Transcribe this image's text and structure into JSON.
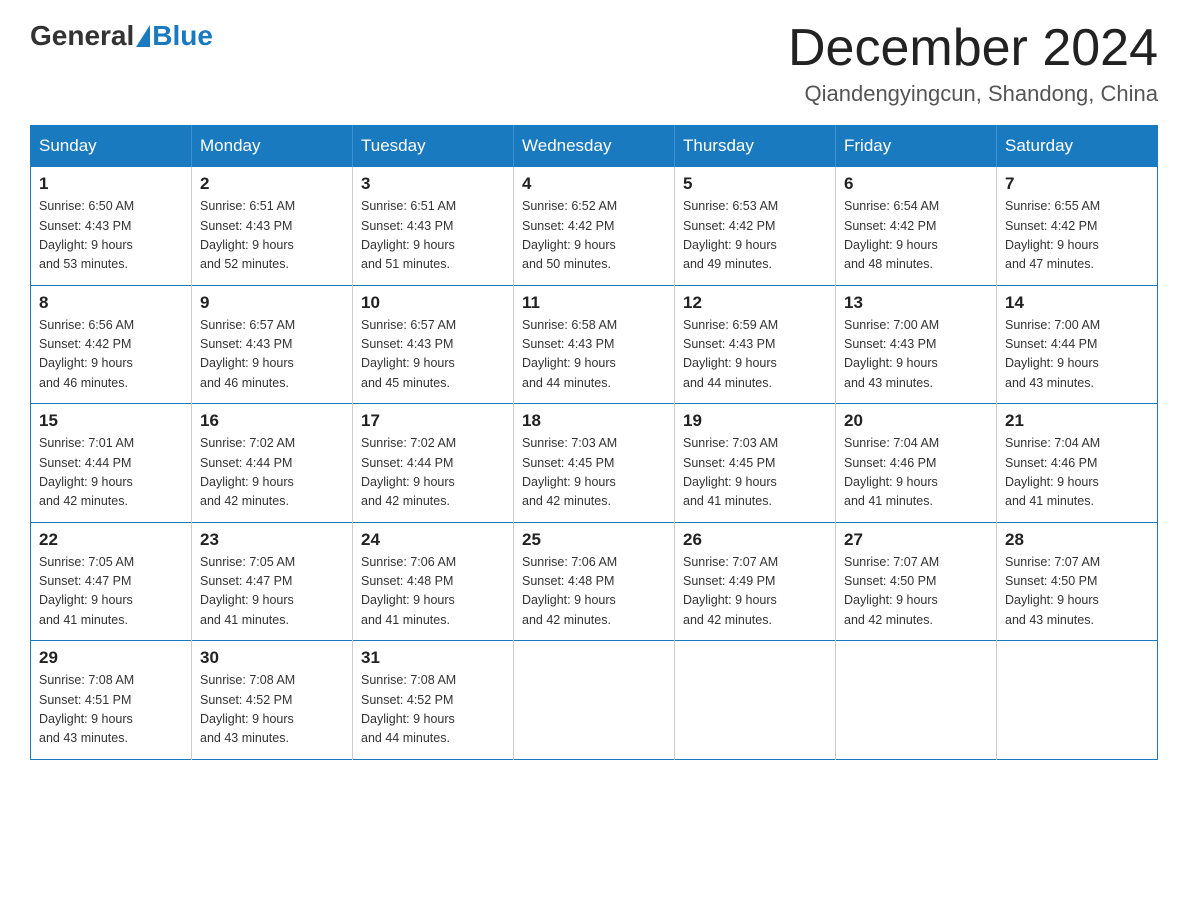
{
  "header": {
    "logo_general": "General",
    "logo_blue": "Blue",
    "month_title": "December 2024",
    "location": "Qiandengyingcun, Shandong, China"
  },
  "days_of_week": [
    "Sunday",
    "Monday",
    "Tuesday",
    "Wednesday",
    "Thursday",
    "Friday",
    "Saturday"
  ],
  "weeks": [
    [
      {
        "day": "1",
        "sunrise": "6:50 AM",
        "sunset": "4:43 PM",
        "daylight": "9 hours and 53 minutes."
      },
      {
        "day": "2",
        "sunrise": "6:51 AM",
        "sunset": "4:43 PM",
        "daylight": "9 hours and 52 minutes."
      },
      {
        "day": "3",
        "sunrise": "6:51 AM",
        "sunset": "4:43 PM",
        "daylight": "9 hours and 51 minutes."
      },
      {
        "day": "4",
        "sunrise": "6:52 AM",
        "sunset": "4:42 PM",
        "daylight": "9 hours and 50 minutes."
      },
      {
        "day": "5",
        "sunrise": "6:53 AM",
        "sunset": "4:42 PM",
        "daylight": "9 hours and 49 minutes."
      },
      {
        "day": "6",
        "sunrise": "6:54 AM",
        "sunset": "4:42 PM",
        "daylight": "9 hours and 48 minutes."
      },
      {
        "day": "7",
        "sunrise": "6:55 AM",
        "sunset": "4:42 PM",
        "daylight": "9 hours and 47 minutes."
      }
    ],
    [
      {
        "day": "8",
        "sunrise": "6:56 AM",
        "sunset": "4:42 PM",
        "daylight": "9 hours and 46 minutes."
      },
      {
        "day": "9",
        "sunrise": "6:57 AM",
        "sunset": "4:43 PM",
        "daylight": "9 hours and 46 minutes."
      },
      {
        "day": "10",
        "sunrise": "6:57 AM",
        "sunset": "4:43 PM",
        "daylight": "9 hours and 45 minutes."
      },
      {
        "day": "11",
        "sunrise": "6:58 AM",
        "sunset": "4:43 PM",
        "daylight": "9 hours and 44 minutes."
      },
      {
        "day": "12",
        "sunrise": "6:59 AM",
        "sunset": "4:43 PM",
        "daylight": "9 hours and 44 minutes."
      },
      {
        "day": "13",
        "sunrise": "7:00 AM",
        "sunset": "4:43 PM",
        "daylight": "9 hours and 43 minutes."
      },
      {
        "day": "14",
        "sunrise": "7:00 AM",
        "sunset": "4:44 PM",
        "daylight": "9 hours and 43 minutes."
      }
    ],
    [
      {
        "day": "15",
        "sunrise": "7:01 AM",
        "sunset": "4:44 PM",
        "daylight": "9 hours and 42 minutes."
      },
      {
        "day": "16",
        "sunrise": "7:02 AM",
        "sunset": "4:44 PM",
        "daylight": "9 hours and 42 minutes."
      },
      {
        "day": "17",
        "sunrise": "7:02 AM",
        "sunset": "4:44 PM",
        "daylight": "9 hours and 42 minutes."
      },
      {
        "day": "18",
        "sunrise": "7:03 AM",
        "sunset": "4:45 PM",
        "daylight": "9 hours and 42 minutes."
      },
      {
        "day": "19",
        "sunrise": "7:03 AM",
        "sunset": "4:45 PM",
        "daylight": "9 hours and 41 minutes."
      },
      {
        "day": "20",
        "sunrise": "7:04 AM",
        "sunset": "4:46 PM",
        "daylight": "9 hours and 41 minutes."
      },
      {
        "day": "21",
        "sunrise": "7:04 AM",
        "sunset": "4:46 PM",
        "daylight": "9 hours and 41 minutes."
      }
    ],
    [
      {
        "day": "22",
        "sunrise": "7:05 AM",
        "sunset": "4:47 PM",
        "daylight": "9 hours and 41 minutes."
      },
      {
        "day": "23",
        "sunrise": "7:05 AM",
        "sunset": "4:47 PM",
        "daylight": "9 hours and 41 minutes."
      },
      {
        "day": "24",
        "sunrise": "7:06 AM",
        "sunset": "4:48 PM",
        "daylight": "9 hours and 41 minutes."
      },
      {
        "day": "25",
        "sunrise": "7:06 AM",
        "sunset": "4:48 PM",
        "daylight": "9 hours and 42 minutes."
      },
      {
        "day": "26",
        "sunrise": "7:07 AM",
        "sunset": "4:49 PM",
        "daylight": "9 hours and 42 minutes."
      },
      {
        "day": "27",
        "sunrise": "7:07 AM",
        "sunset": "4:50 PM",
        "daylight": "9 hours and 42 minutes."
      },
      {
        "day": "28",
        "sunrise": "7:07 AM",
        "sunset": "4:50 PM",
        "daylight": "9 hours and 43 minutes."
      }
    ],
    [
      {
        "day": "29",
        "sunrise": "7:08 AM",
        "sunset": "4:51 PM",
        "daylight": "9 hours and 43 minutes."
      },
      {
        "day": "30",
        "sunrise": "7:08 AM",
        "sunset": "4:52 PM",
        "daylight": "9 hours and 43 minutes."
      },
      {
        "day": "31",
        "sunrise": "7:08 AM",
        "sunset": "4:52 PM",
        "daylight": "9 hours and 44 minutes."
      },
      null,
      null,
      null,
      null
    ]
  ],
  "labels": {
    "sunrise": "Sunrise:",
    "sunset": "Sunset:",
    "daylight": "Daylight:"
  }
}
